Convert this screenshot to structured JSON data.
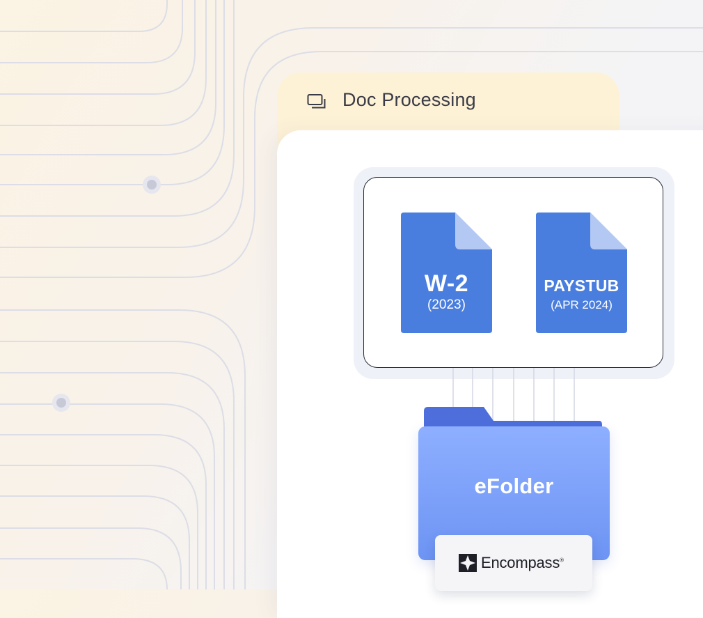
{
  "panel": {
    "title": "Doc Processing",
    "icon": "stacked-window-icon"
  },
  "documents": [
    {
      "title": "W-2",
      "subtitle": "(2023)",
      "icon": "document-icon",
      "color": "#4a7ede"
    },
    {
      "title": "PAYSTUB",
      "subtitle": "(APR 2024)",
      "icon": "document-icon",
      "color": "#4a7ede"
    }
  ],
  "efolder": {
    "label": "eFolder",
    "color": "#7a9ff8",
    "brand": "Encompass",
    "brand_mark": "®",
    "brand_icon": "encompass-logo-icon"
  },
  "colors": {
    "accent_blue": "#4a7ede",
    "tab_cream": "#fdf2d6",
    "background_line": "#dcdde6"
  }
}
